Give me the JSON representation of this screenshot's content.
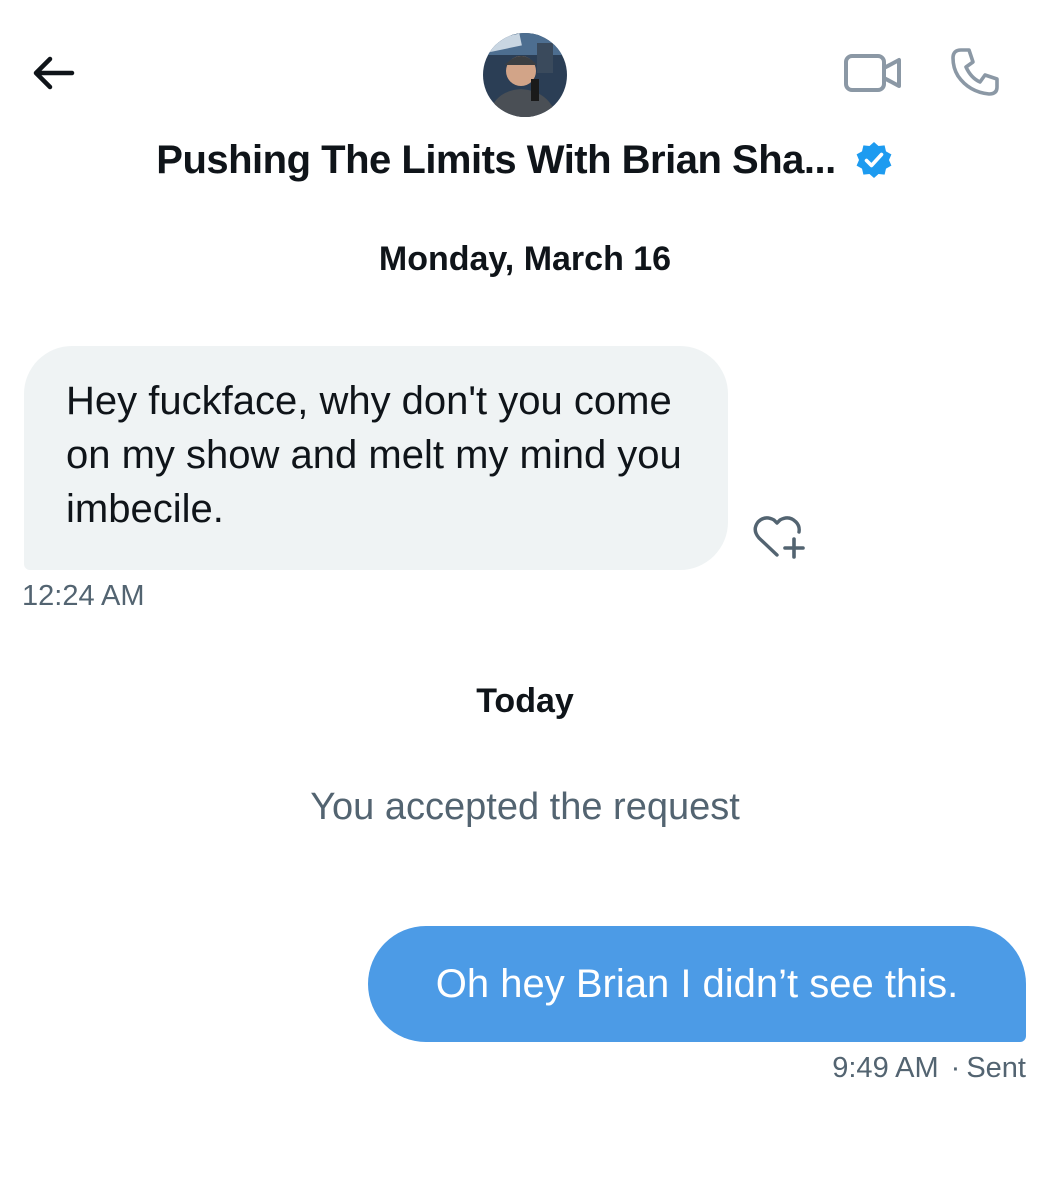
{
  "header": {
    "back_icon": "arrow-left-icon",
    "avatar_icon": "profile-photo",
    "title": "Pushing The Limits With Brian Sha...",
    "verified_icon": "verified-badge-icon",
    "video_icon": "video-camera-icon",
    "call_icon": "phone-icon"
  },
  "conversation": {
    "date_1": "Monday, March 16",
    "received_message": {
      "text": "Hey fuckface, why don't you come on my show and melt my mind you imbecile.",
      "time": "12:24 AM",
      "react_icon": "heart-plus-icon"
    },
    "date_2": "Today",
    "system_message": "You accepted the request",
    "sent_message": {
      "text": "Oh hey Brian I didn’t see this.",
      "time": "9:49 AM",
      "separator": "·",
      "status": "Sent"
    }
  },
  "colors": {
    "accent": "#1d9bf0",
    "sent_bubble": "#4c9be6",
    "received_bubble": "#eff3f4",
    "secondary_text": "#536471"
  }
}
